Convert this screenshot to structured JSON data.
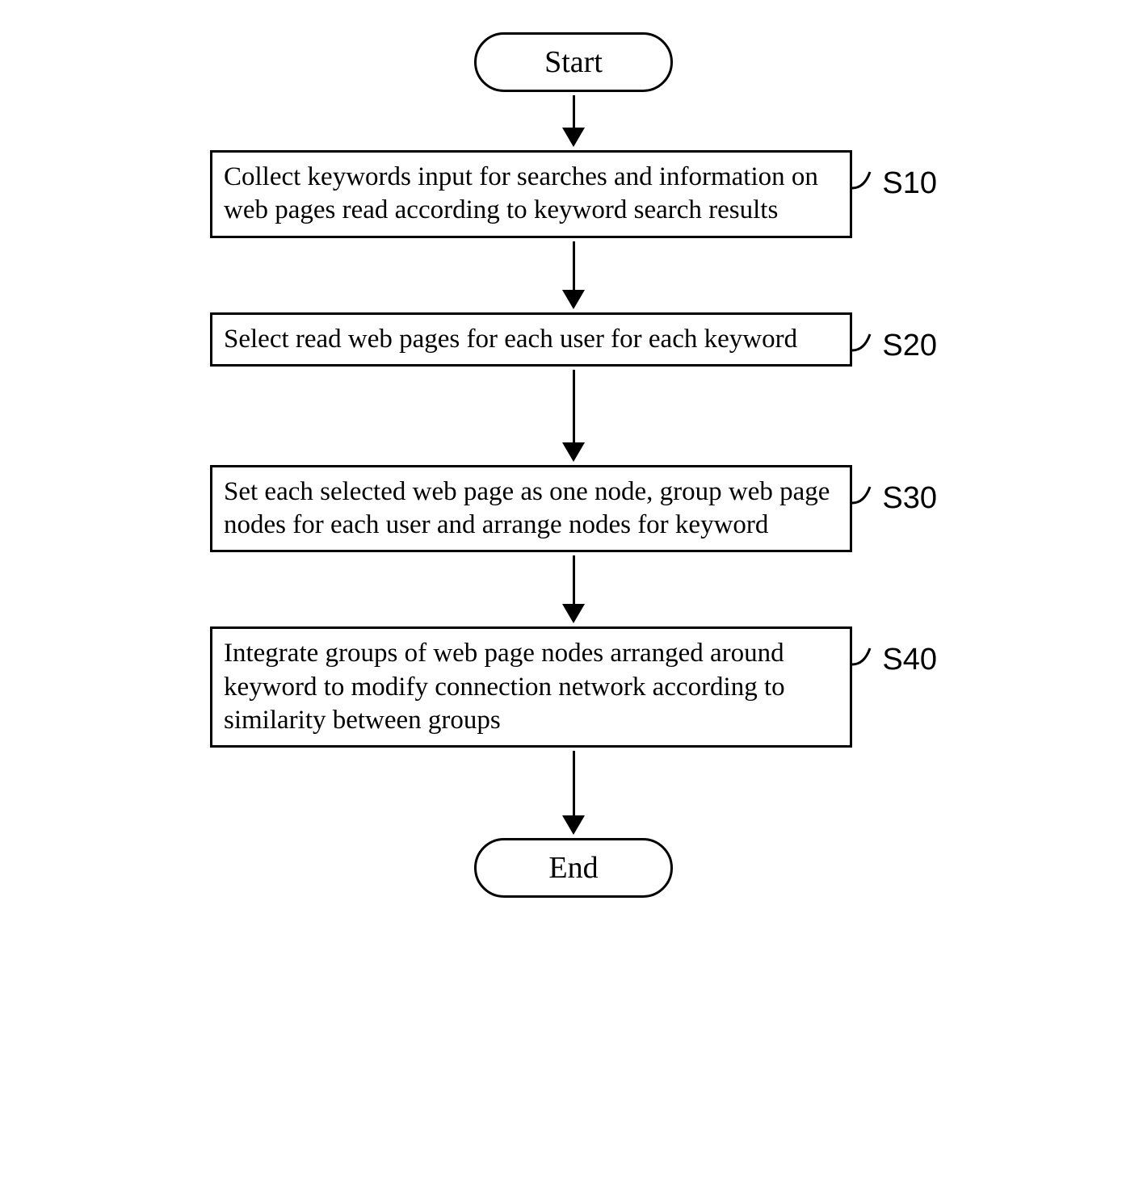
{
  "flowchart": {
    "start": "Start",
    "end": "End",
    "steps": [
      {
        "text": "Collect keywords input for searches and information on web pages read according to keyword search results",
        "label": "S10"
      },
      {
        "text": "Select read web pages for each user for each keyword",
        "label": "S20"
      },
      {
        "text": "Set each selected web page as one node, group web page nodes for each user and arrange nodes for keyword",
        "label": "S30"
      },
      {
        "text": "Integrate groups of web page nodes arranged around keyword to modify connection network according to similarity between groups",
        "label": "S40"
      }
    ]
  }
}
